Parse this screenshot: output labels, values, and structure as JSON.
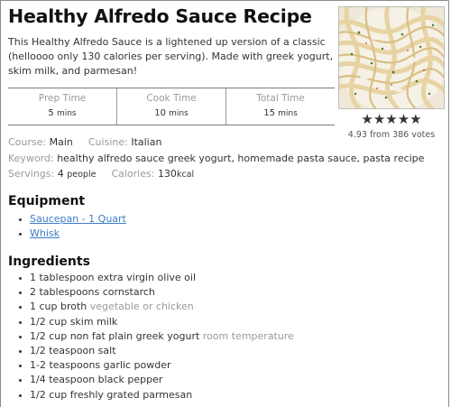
{
  "recipe": {
    "title": "Healthy Alfredo Sauce Recipe",
    "summary": "This Healthy Alfredo Sauce is a lightened up version of a classic (helloooo only 130 calories per serving). Made with greek yogurt, skim milk, and parmesan!",
    "times": [
      {
        "label": "Prep Time",
        "value": "5",
        "unit": "mins"
      },
      {
        "label": "Cook Time",
        "value": "10",
        "unit": "mins"
      },
      {
        "label": "Total Time",
        "value": "15",
        "unit": "mins"
      }
    ],
    "rating": {
      "stars": "★★★★★",
      "votes_text": "4.93 from 386 votes",
      "value": 4.93,
      "max": 5
    },
    "course": {
      "label": "Course:",
      "value": "Main"
    },
    "cuisine": {
      "label": "Cuisine:",
      "value": "Italian"
    },
    "keyword": {
      "label": "Keyword:",
      "value": "healthy alfredo sauce greek yogurt, homemade pasta sauce, pasta recipe"
    },
    "servings": {
      "label": "Servings:",
      "value": "4",
      "unit": "people"
    },
    "calories": {
      "label": "Calories:",
      "value": "130",
      "unit": "kcal"
    }
  },
  "equipment": {
    "heading": "Equipment",
    "items": [
      {
        "label": "Saucepan - 1 Quart"
      },
      {
        "label": "Whisk"
      }
    ]
  },
  "ingredients": {
    "heading": "Ingredients",
    "items": [
      {
        "text": "1 tablespoon extra virgin olive oil",
        "note": ""
      },
      {
        "text": "2 tablespoons cornstarch",
        "note": ""
      },
      {
        "text": "1 cup broth",
        "note": "vegetable or chicken"
      },
      {
        "text": "1/2 cup skim milk",
        "note": ""
      },
      {
        "text": "1/2 cup non fat plain greek yogurt",
        "note": "room temperature"
      },
      {
        "text": "1/2 teaspoon salt",
        "note": ""
      },
      {
        "text": "1-2 teaspoons garlic powder",
        "note": ""
      },
      {
        "text": "1/4 teaspoon black pepper",
        "note": ""
      },
      {
        "text": "1/2 cup freshly grated parmesan",
        "note": ""
      }
    ]
  },
  "colors": {
    "link": "#3d7cc9",
    "muted": "#9a9a9a",
    "text": "#333333",
    "heading": "#111111"
  },
  "icons": {
    "rating": "star-icon",
    "photo": "pasta-photo"
  }
}
